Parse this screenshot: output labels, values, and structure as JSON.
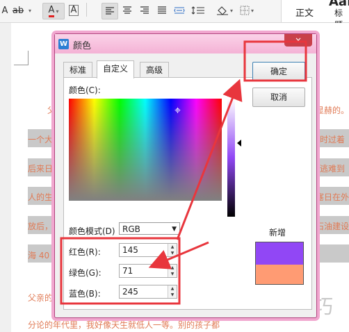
{
  "ribbon": {
    "font_a": "A",
    "strike": "ab",
    "font_color_a": "A",
    "char_shade_a": "A",
    "caret": "▾",
    "style_normal": "正文",
    "style_heading_sample": "AaI",
    "style_heading": "标题"
  },
  "document": {
    "lines": [
      {
        "left": "父",
        "right": "显赫的。"
      },
      {
        "left": "一个大",
        "right": "时过着"
      },
      {
        "left": "后来日",
        "right": "逃难到"
      },
      {
        "left": "人的生",
        "right": "塞日在外"
      },
      {
        "left": "放后，",
        "right": "石油建设"
      },
      {
        "left": "海 40",
        "right": ""
      },
      {
        "left": "父亲的",
        "right": ""
      },
      {
        "left": "分论的年代里，我好像天生就低人一等。别的孩子都",
        "right": ""
      }
    ],
    "watermark": "软件技巧"
  },
  "dialog": {
    "title": "颜色",
    "close": "×",
    "tabs": [
      "标准",
      "自定义",
      "高级"
    ],
    "active_tab": "自定义",
    "color_label": "颜色(C):",
    "mode_label": "颜色模式(D)",
    "mode_value": "RGB",
    "red_label": "红色(R):",
    "red_value": "145",
    "green_label": "绿色(G):",
    "green_value": "71",
    "blue_label": "蓝色(B):",
    "blue_value": "245",
    "ok": "确定",
    "cancel": "取消",
    "new_label": "新增",
    "new_color": "#9147f5",
    "current_color": "#ff9b73"
  },
  "annotation_color": "#e8363d"
}
